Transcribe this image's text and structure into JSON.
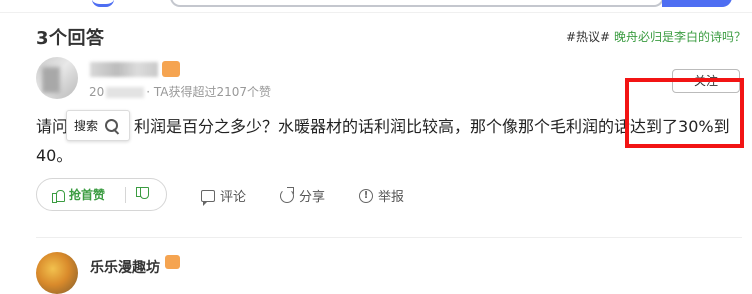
{
  "answers_header": {
    "count_label": "3个回答"
  },
  "topic": {
    "prefix": "#热议#",
    "link": "晚舟必归是李白的诗吗？"
  },
  "answer": {
    "meta_prefix": "20",
    "meta_suffix": "· TA获得超过2107个赞",
    "follow_label": "关注",
    "text_before": "请问",
    "text_after": "利润是百分之多少？水暖器材的话利润比较高，那个像那个毛利润的话达到了30%到40。"
  },
  "search_tip": {
    "label": "搜索",
    "icon": "search-icon"
  },
  "actions": {
    "like_label": "抢首赞",
    "comment_label": "评论",
    "share_label": "分享",
    "report_label": "举报"
  },
  "next_answer": {
    "username": "乐乐漫趣坊"
  },
  "colors": {
    "accent": "#3b9c41",
    "highlight": "#f21414",
    "brand": "#4e6ef2"
  }
}
